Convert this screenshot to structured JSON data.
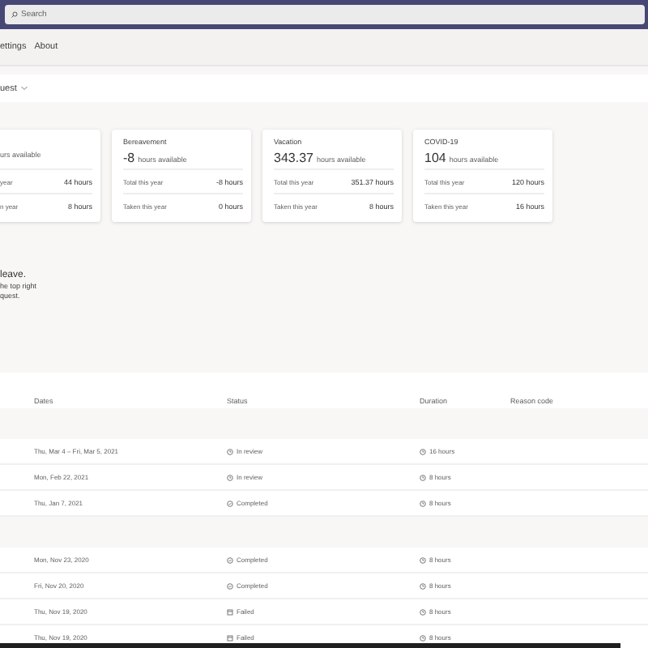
{
  "search": {
    "placeholder": "Search"
  },
  "nav": [
    "ettings",
    "About"
  ],
  "request_button": "uest",
  "cards": [
    {
      "unit": "urs available",
      "rows": [
        {
          "label": "year",
          "value": "44 hours"
        },
        {
          "label": "n year",
          "value": "8 hours"
        }
      ]
    },
    {
      "title": "Bereavement",
      "number": "-8",
      "unit": "hours available",
      "rows": [
        {
          "label": "Total this year",
          "value": "-8 hours"
        },
        {
          "label": "Taken this year",
          "value": "0 hours"
        }
      ]
    },
    {
      "title": "Vacation",
      "number": "343.37",
      "unit": "hours available",
      "rows": [
        {
          "label": "Total this year",
          "value": "351.37 hours"
        },
        {
          "label": "Taken this year",
          "value": "8 hours"
        }
      ]
    },
    {
      "title": "COVID-19",
      "number": "104",
      "unit": "hours available",
      "rows": [
        {
          "label": "Total this year",
          "value": "120 hours"
        },
        {
          "label": "Taken this year",
          "value": "16 hours"
        }
      ]
    }
  ],
  "message": {
    "heading": "leave.",
    "lines": [
      "he top right",
      "quest."
    ]
  },
  "table": {
    "columns": [
      "Dates",
      "Status",
      "Duration",
      "Reason code"
    ],
    "groups": [
      {
        "rows": [
          {
            "dates": "Thu, Mar 4 – Fri, Mar 5, 2021",
            "status": "In review",
            "kind": "review",
            "duration": "16 hours"
          },
          {
            "dates": "Mon, Feb 22, 2021",
            "status": "In review",
            "kind": "review",
            "duration": "8 hours"
          },
          {
            "dates": "Thu, Jan 7, 2021",
            "status": "Completed",
            "kind": "completed",
            "duration": "8 hours"
          }
        ]
      },
      {
        "rows": [
          {
            "dates": "Mon, Nov 23, 2020",
            "status": "Completed",
            "kind": "completed",
            "duration": "8 hours"
          },
          {
            "dates": "Fri, Nov 20, 2020",
            "status": "Completed",
            "kind": "completed",
            "duration": "8 hours"
          },
          {
            "dates": "Thu, Nov 19, 2020",
            "status": "Failed",
            "kind": "failed",
            "duration": "8 hours"
          },
          {
            "dates": "Thu, Nov 19, 2020",
            "status": "Failed",
            "kind": "failed",
            "duration": "8 hours"
          }
        ]
      }
    ]
  }
}
